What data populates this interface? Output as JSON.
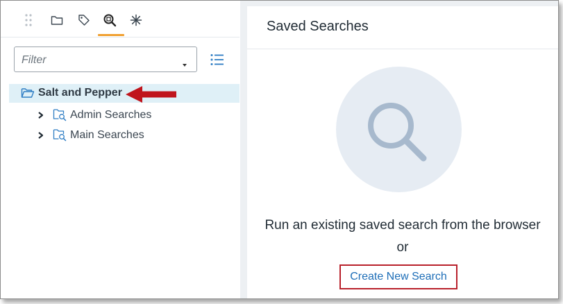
{
  "toolbar": {
    "items": [
      {
        "name": "drag-handle-icon"
      },
      {
        "name": "folder-icon"
      },
      {
        "name": "tag-icon"
      },
      {
        "name": "saved-search-icon",
        "active": true
      },
      {
        "name": "asterisk-icon"
      }
    ],
    "active_color": "#f0a030"
  },
  "filter": {
    "placeholder": "Filter",
    "value": ""
  },
  "tree": {
    "root": {
      "label": "Salt and Pepper",
      "icon": "open-folder-icon",
      "selected": true
    },
    "children": [
      {
        "label": "Admin Searches",
        "icon": "search-folder-icon",
        "expanded": false
      },
      {
        "label": "Main Searches",
        "icon": "search-folder-icon",
        "expanded": false
      }
    ]
  },
  "annotation": {
    "arrow_color": "#c0141c",
    "icon": "arrow-left-icon"
  },
  "panel": {
    "title": "Saved Searches",
    "message": "Run an existing saved search from the browser",
    "or_text": "or",
    "create_button_label": "Create New Search",
    "highlight_color": "#b8202a"
  }
}
